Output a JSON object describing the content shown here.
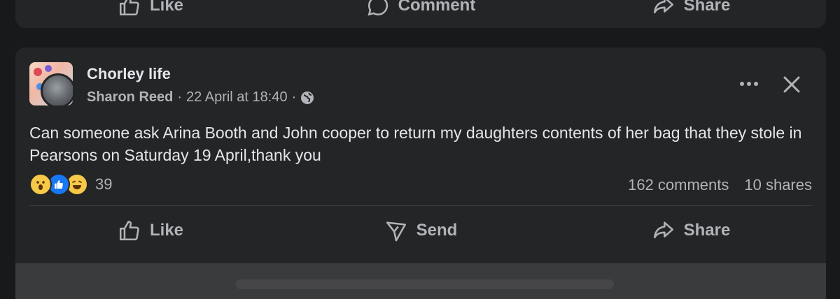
{
  "previous_post": {
    "actions": [
      {
        "label": "Like",
        "icon": "thumbs-up-icon"
      },
      {
        "label": "Comment",
        "icon": "comment-icon"
      },
      {
        "label": "Share",
        "icon": "share-icon"
      }
    ]
  },
  "post": {
    "group_name": "Chorley life",
    "author": "Sharon Reed",
    "separator": "·",
    "timestamp": "22 April at 18:40",
    "privacy_icon": "globe-icon",
    "text": "Can someone ask Arina Booth and John cooper to return my daughters contents of her bag that they stole in Pearsons on Saturday 19 April,thank you",
    "reaction_icons": [
      "wow-reaction-icon",
      "like-reaction-icon",
      "haha-reaction-icon"
    ],
    "reaction_count": "39",
    "comments": "162 comments",
    "shares": "10 shares",
    "actions": [
      {
        "label": "Like",
        "icon": "thumbs-up-icon"
      },
      {
        "label": "Send",
        "icon": "send-icon"
      },
      {
        "label": "Share",
        "icon": "share-icon"
      }
    ]
  },
  "colors": {
    "background": "#18191a",
    "card": "#242526",
    "text_primary": "#e4e6eb",
    "text_secondary": "#b0b3b8",
    "like_blue": "#1877f2",
    "emoji_yellow": "#f7c948"
  }
}
